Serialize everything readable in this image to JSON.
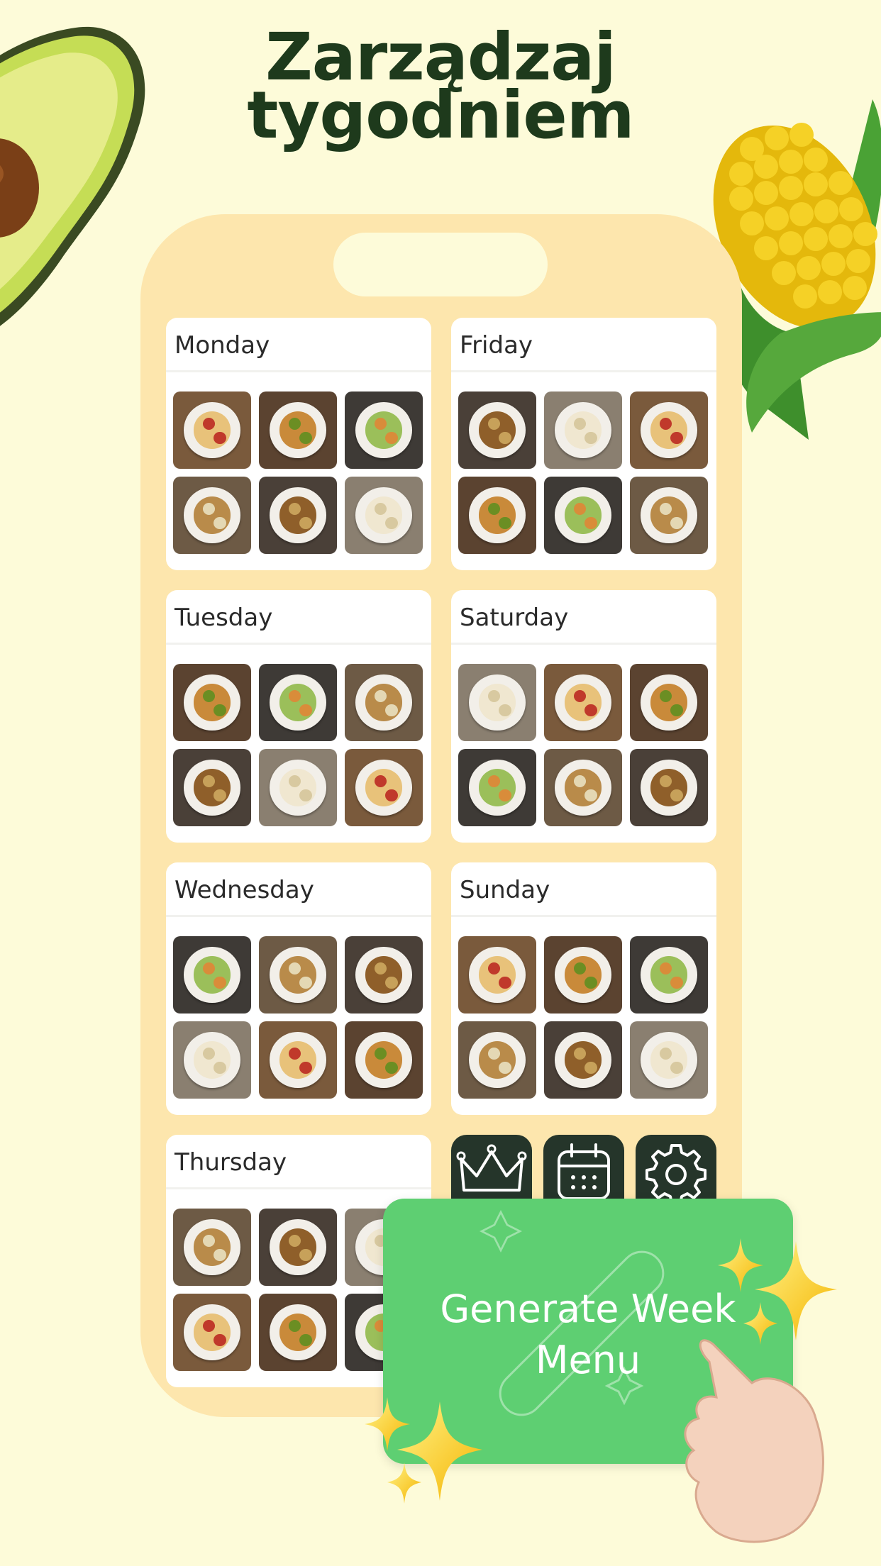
{
  "headline": {
    "line1": "Zarządzaj",
    "line2": "tygodniem"
  },
  "days": [
    {
      "name": "Monday",
      "meals": [
        "breakfast-plate",
        "roast-chicken",
        "grilled-asparagus",
        "fish-fillets",
        "beef-stew",
        "cream-soup"
      ]
    },
    {
      "name": "Tuesday",
      "meals": [
        "oatmeal-bowl",
        "roast-chicken-platter",
        "shrimp-skewers",
        "stuffed-peppers",
        "rice-bowl",
        "green-smoothie"
      ]
    },
    {
      "name": "Wednesday",
      "meals": [
        "yogurt-parfait",
        "granola-bars",
        "pasta-broccoli",
        "celery-dip",
        "stuffed-avocado",
        "nut-yogurt"
      ]
    },
    {
      "name": "Thursday",
      "meals": [
        "pancakes-berries",
        "carrot-hummus",
        "pasta-sauce",
        "roasted-chicken-veg",
        "club-sandwich",
        "edamame"
      ]
    },
    {
      "name": "Friday",
      "meals": [
        "berry-parfaits",
        "steak-sweet-potato",
        "soup-toast",
        "cinnamon-rolls",
        "pineapple-rice",
        "bean-salad"
      ]
    },
    {
      "name": "Saturday",
      "meals": [
        "pancake-stack",
        "grilled-sandwich",
        "veggie-pizza",
        "edamame-bowl",
        "caprese-bites",
        "quinoa-salad"
      ]
    },
    {
      "name": "Sunday",
      "meals": [
        "waffles-berries",
        "mixed-nuts",
        "fish-greens",
        "chicken-tenders",
        "banana-oats",
        "carrot-sticks-dip"
      ]
    }
  ],
  "nav": [
    {
      "icon": "crown-icon"
    },
    {
      "icon": "calendar-icon"
    },
    {
      "icon": "gear-icon"
    }
  ],
  "generate_button": {
    "line1": "Generate Week",
    "line2": "Menu"
  },
  "colors": {
    "background": "#fdfbd9",
    "phone": "#fde6ad",
    "headline": "#1e3a1c",
    "button": "#5ecf72",
    "nav": "#25352a"
  }
}
